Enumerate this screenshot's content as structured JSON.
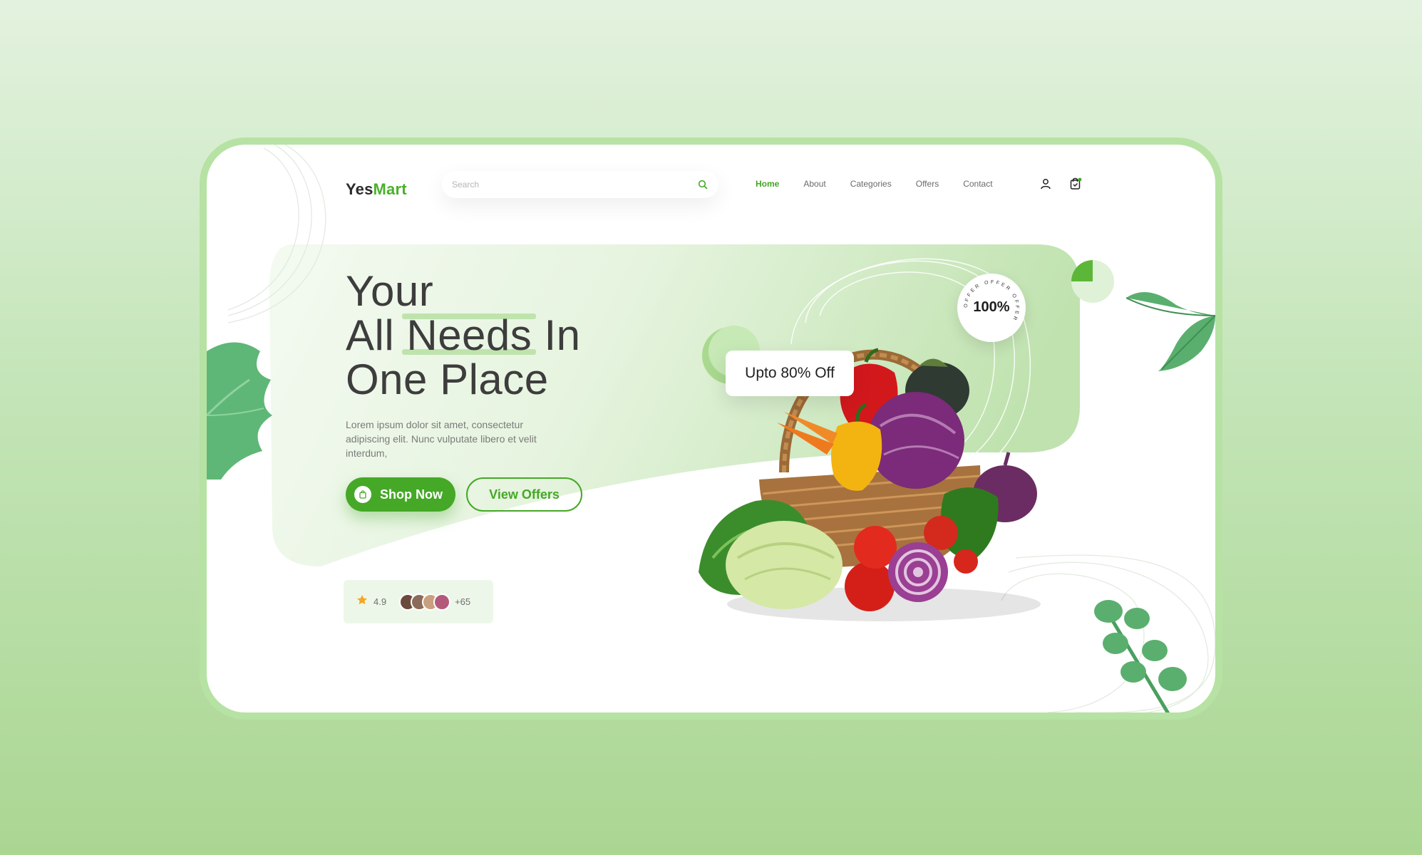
{
  "brand": {
    "name_prefix": "Yes",
    "name_suffix": "Mart"
  },
  "search": {
    "placeholder": "Search"
  },
  "nav": [
    "Home",
    "About",
    "Categories",
    "Offers",
    "Contact"
  ],
  "hero": {
    "headline_line1": "Your",
    "headline_line2_a": "All ",
    "headline_line2_b": "Needs",
    "headline_line2_c": " In",
    "headline_line3": "One Place",
    "description": "Lorem ipsum dolor sit amet, consectetur adipiscing elit. Nunc vulputate libero et velit interdum,",
    "shop_button": "Shop Now",
    "offers_button": "View Offers"
  },
  "promo": {
    "off_label": "Upto 80% Off",
    "circle_pct": "100%",
    "circle_ring_text": "OFFER OFFER OFFER"
  },
  "rating": {
    "value": "4.9",
    "more": "+65"
  },
  "colors": {
    "brand_green": "#45a827",
    "background_green": "#b6e2a3",
    "panel_green": "#cfeac3",
    "leaf_green": "#5aaf6e"
  },
  "icons": [
    "search-icon",
    "user-icon",
    "cart-icon",
    "bag-icon",
    "star-icon"
  ]
}
